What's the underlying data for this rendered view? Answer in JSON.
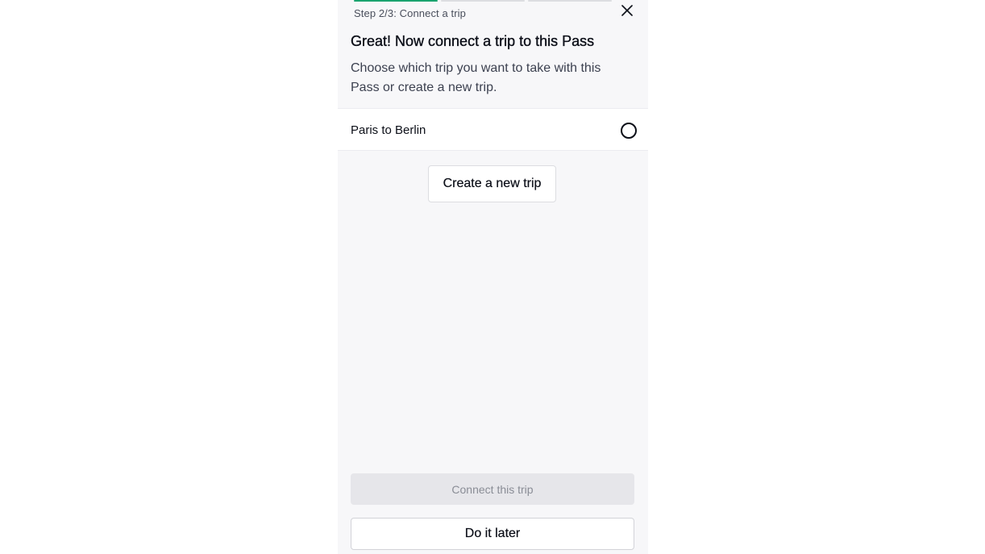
{
  "progress": {
    "total_steps": 3,
    "completed_segments": 1,
    "step_label": "Step 2/3: Connect a trip"
  },
  "close": {
    "icon": "close-icon"
  },
  "header": {
    "title": "Great! Now connect a trip to this Pass",
    "subtitle": "Choose which trip you want to take with this Pass or create a new trip."
  },
  "trips": [
    {
      "name": "Paris to Berlin",
      "selected": false
    }
  ],
  "buttons": {
    "create_label": "Create a new trip",
    "connect_label": "Connect this trip",
    "connect_disabled": true,
    "later_label": "Do it later"
  },
  "colors": {
    "progress_active": "#1aa36f",
    "progress_inactive": "#dcdde1",
    "background": "#f7f7f9",
    "text_primary": "#0c0f18",
    "disabled_bg": "#e6e6ea",
    "disabled_text": "#8a8d96"
  }
}
